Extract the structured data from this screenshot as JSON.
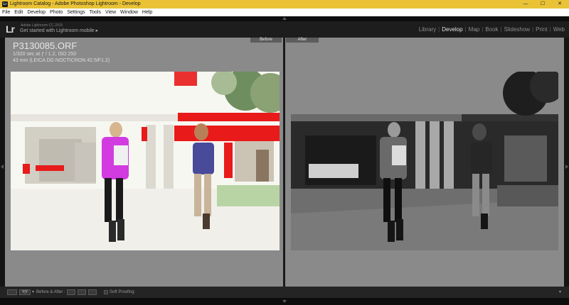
{
  "window": {
    "title": "Lightroom Catalog - Adobe Photoshop Lightroom - Develop",
    "app_icon_text": "Lr",
    "minimize_glyph": "—",
    "maximize_glyph": "☐",
    "close_glyph": "✕"
  },
  "menu": [
    "File",
    "Edit",
    "Develop",
    "Photo",
    "Settings",
    "Tools",
    "View",
    "Window",
    "Help"
  ],
  "identity_plate": {
    "logo": "Lr",
    "product": "Adobe Lightroom CC 2015",
    "subtitle": "Get started with Lightroom mobile ▸"
  },
  "modules": [
    {
      "label": "Library",
      "active": false
    },
    {
      "label": "Develop",
      "active": true
    },
    {
      "label": "Map",
      "active": false
    },
    {
      "label": "Book",
      "active": false
    },
    {
      "label": "Slideshow",
      "active": false
    },
    {
      "label": "Print",
      "active": false
    },
    {
      "label": "Web",
      "active": false
    }
  ],
  "view": {
    "before_label": "Before",
    "after_label": "After"
  },
  "photo_info": {
    "filename": "P3130085.ORF",
    "exposure": "1/320 sec at ƒ / 1.2, ISO 250",
    "lens": "43 mm (LEICA DG NOCTICRON 42.5/F1.2)"
  },
  "toolbar": {
    "view_mode_label": "Y|Y",
    "before_after_label": "Before & After :",
    "soft_proofing_label": "Soft Proofing",
    "soft_proofing_checked": false
  },
  "colors": {
    "clipping_warning": "#e81a1a",
    "magenta_warning": "#d23be0",
    "active_module": "#e0e0e0",
    "titlebar": "#e9c236"
  }
}
